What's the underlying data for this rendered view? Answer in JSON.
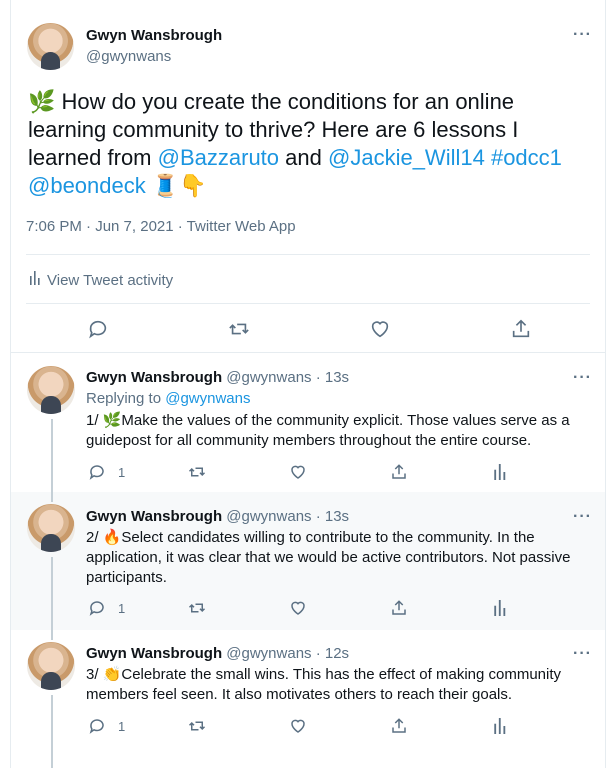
{
  "main_tweet": {
    "name": "Gwyn Wansbrough",
    "handle": "@gwynwans",
    "text_prefix": "How do you create the conditions for an online learning community to thrive? Here are 6 lessons I learned from",
    "mention_1": "@Bazzaruto",
    "and": "and",
    "mention_2": "@Jackie_Will14",
    "hashtag": "#odcc1",
    "mention_3": "@beondeck",
    "lead_emoji": "🌿",
    "trail_emoji": "🧵👇",
    "timestamp": "7:06 PM · Jun 7, 2021 · Twitter Web App",
    "activity_label": "View Tweet activity"
  },
  "replies": [
    {
      "name": "Gwyn Wansbrough",
      "handle": "@gwynwans · 13s",
      "replying_prefix": "Replying to",
      "replying_to": "@gwynwans",
      "prefix": "1/",
      "emoji": "🌿",
      "text": "Make the values of the community explicit. Those values serve as a guidepost for all community members throughout the entire course.",
      "reply_count": "1"
    },
    {
      "name": "Gwyn Wansbrough",
      "handle": "@gwynwans · 13s",
      "prefix": "2/",
      "emoji": "🔥",
      "text": "Select candidates willing to contribute to the community. In the application, it was clear that we would be active contributors. Not passive participants.",
      "reply_count": "1"
    },
    {
      "name": "Gwyn Wansbrough",
      "handle": "@gwynwans · 12s",
      "prefix": "3/",
      "emoji": "👏",
      "text": "Celebrate the small wins. This has the effect of making community members feel seen. It also motivates others to reach their goals.",
      "reply_count": "1"
    }
  ],
  "more_glyph": "···",
  "colors": {
    "link": "#1b95e0",
    "muted": "#5b7083",
    "border": "#e6ecf0",
    "shaded": "#f7f9fa"
  }
}
